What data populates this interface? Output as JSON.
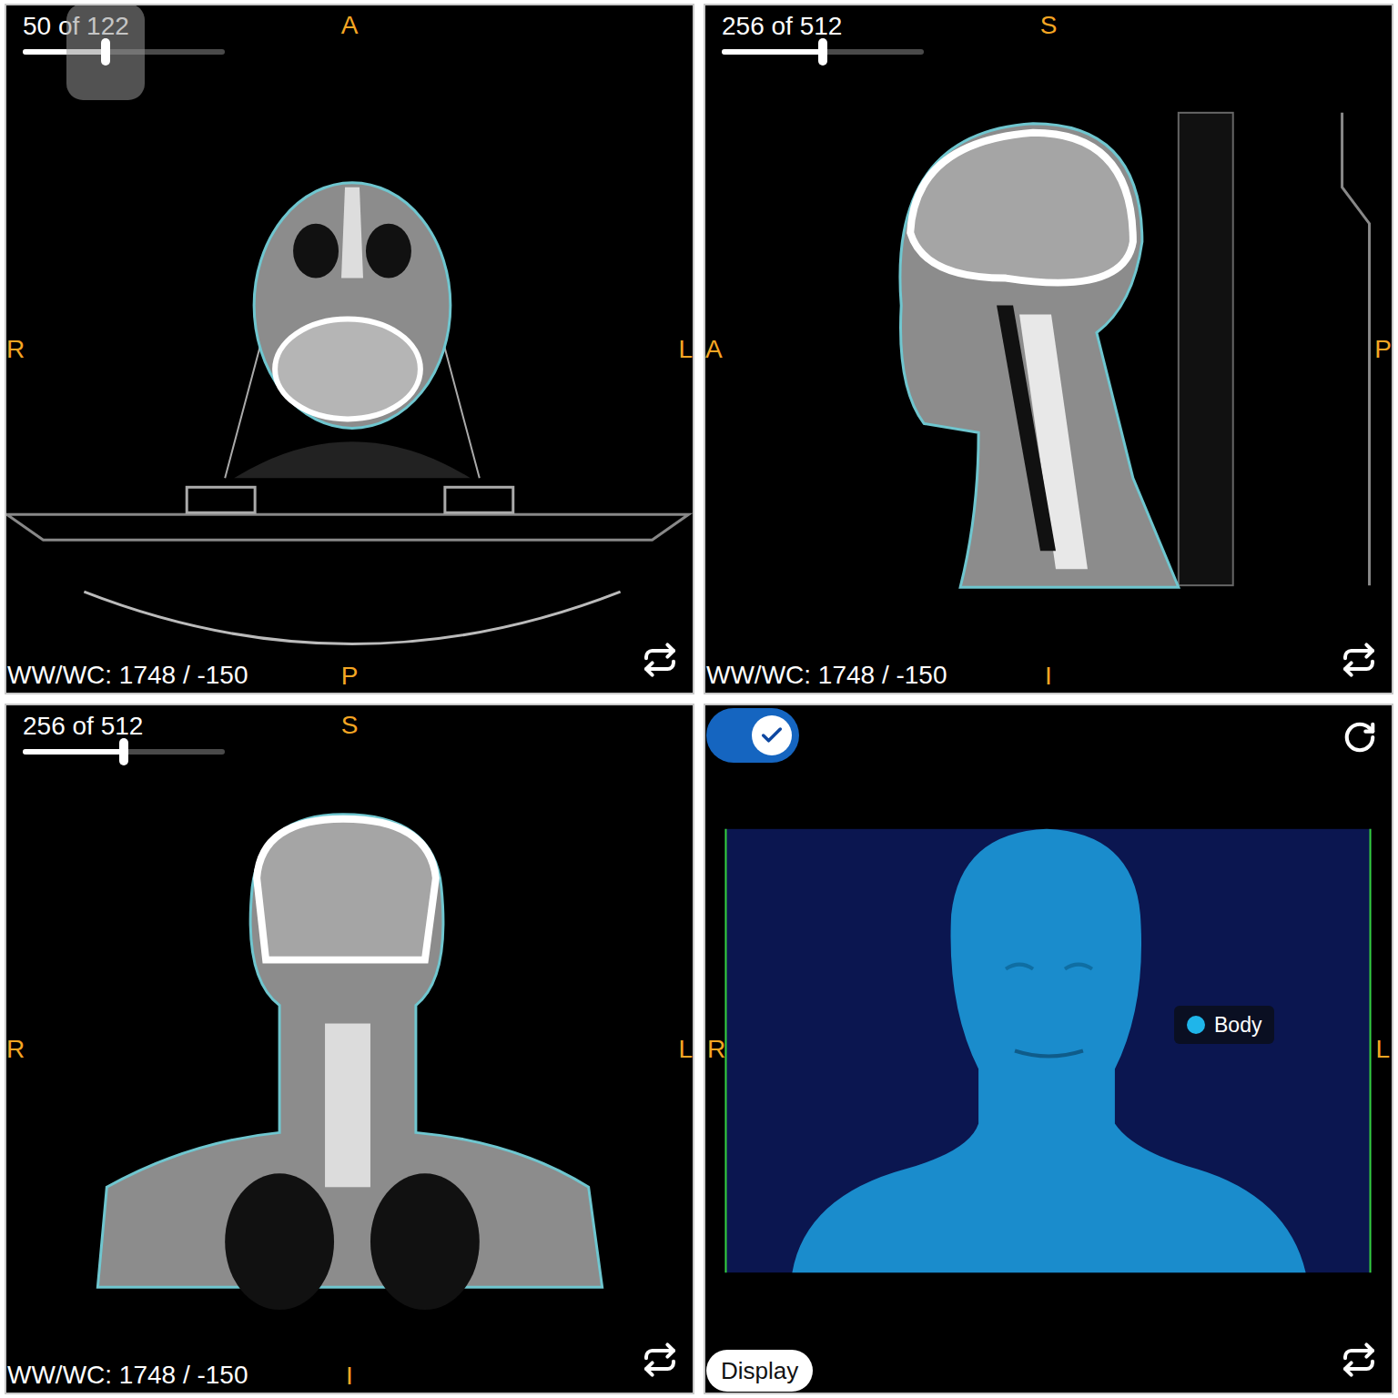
{
  "viewports": [
    {
      "kind": "axial",
      "slice": "50 of 122",
      "level": 0.41,
      "active": true,
      "orientation": {
        "top": "A",
        "bottom": "P",
        "left": "R",
        "right": "L"
      },
      "window_level": "WW/WC: 1748 / -150"
    },
    {
      "kind": "sagittal",
      "slice": "256 of 512",
      "level": 0.5,
      "active": false,
      "orientation": {
        "top": "S",
        "bottom": "I",
        "left": "A",
        "right": "P"
      },
      "window_level": "WW/WC: 1748 / -150"
    },
    {
      "kind": "coronal",
      "slice": "256 of 512",
      "level": 0.5,
      "active": false,
      "orientation": {
        "top": "S",
        "bottom": "I",
        "left": "R",
        "right": "L"
      },
      "window_level": "WW/WC: 1748 / -150"
    }
  ],
  "volume": {
    "toggle_on": true,
    "left": "R",
    "right": "L",
    "legend": [
      {
        "label": "Body",
        "color": "#1fb5ea"
      }
    ],
    "display_button": "Display"
  }
}
